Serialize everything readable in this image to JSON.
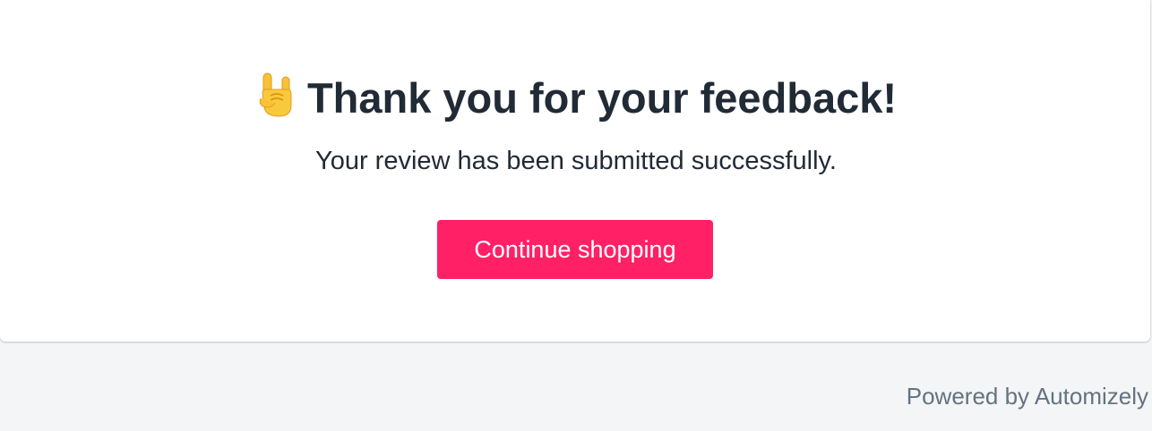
{
  "confirmation": {
    "emoji_icon": "sign-of-the-horns-emoji",
    "title": "Thank you for your feedback!",
    "message": "Your review has been submitted successfully.",
    "button_label": "Continue shopping"
  },
  "footer": {
    "powered_by": "Powered by Automizely"
  },
  "colors": {
    "button_bg": "#ff2066",
    "text_primary": "#212b36",
    "text_secondary": "#637381",
    "page_bg": "#f4f5f7",
    "card_bg": "#ffffff"
  }
}
